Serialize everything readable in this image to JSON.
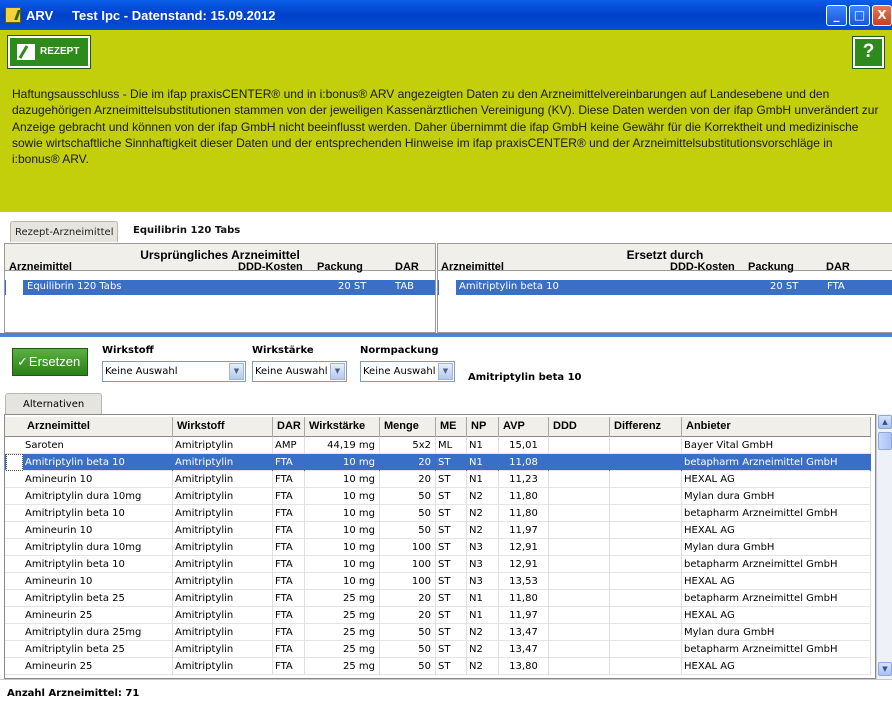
{
  "window": {
    "app": "ARV",
    "title": "Test Ipc - Datenstand: 15.09.2012",
    "controls": {
      "minimize": "_",
      "maximize": "□",
      "close": "X"
    }
  },
  "toolbar": {
    "rezept_label": "REZEPT",
    "help_label": "?"
  },
  "disclaimer": "Haftungsausschluss - Die im ifap praxisCENTER® und in i:bonus® ARV angezeigten Daten zu den Arzneimittelvereinbarungen auf Landesebene und den dazugehörigen Arzneimittelsubstitutionen stammen von der jeweiligen Kassenärztlichen Vereinigung (KV). Diese Daten werden von der ifap GmbH unverändert zur Anzeige gebracht und können von der ifap GmbH nicht beeinflusst werden. Daher übernimmt die ifap GmbH keine Gewähr für die Korrektheit und medizinische sowie wirtschaftliche Sinnhaftigkeit dieser Daten und der entsprechenden Hinweise im ifap praxisCENTER® und der Arzneimittelsubstitutionsvorschläge in i:bonus® ARV.",
  "tabs1": {
    "tab_label": "Rezept-Arzneimittel",
    "drug_title": "Equilibrin 120 Tabs"
  },
  "original": {
    "title": "Ursprüngliches Arzneimittel",
    "headers": {
      "arzneimittel": "Arzneimittel",
      "ddd": "DDD-Kosten",
      "packung": "Packung",
      "dar": "DAR"
    },
    "row": {
      "name": "Equilibrin 120 Tabs",
      "ddd": "",
      "packung": "20 ST",
      "dar": "TAB"
    }
  },
  "replacement": {
    "title": "Ersetzt durch",
    "headers": {
      "arzneimittel": "Arzneimittel",
      "ddd": "DDD-Kosten",
      "packung": "Packung",
      "dar": "DAR"
    },
    "row": {
      "name": "Amitriptylin beta 10",
      "ddd": "",
      "packung": "20 ST",
      "dar": "FTA"
    }
  },
  "filter": {
    "ersetzen_label": "Ersetzen",
    "wirkstoff_label": "Wirkstoff",
    "wirkstoff_value": "Keine Auswahl",
    "staerke_label": "Wirkstärke",
    "staerke_value": "Keine Auswahl",
    "norm_label": "Normpackung",
    "norm_value": "Keine Auswahl",
    "selected_name": "Amitriptylin beta 10"
  },
  "tabs2": {
    "tab_label": "Alternativen"
  },
  "grid": {
    "headers": [
      "Arzneimittel",
      "Wirkstoff",
      "DAR",
      "Wirkstärke",
      "Menge",
      "ME",
      "NP",
      "AVP",
      "DDD",
      "Differenz",
      "Anbieter"
    ],
    "rows": [
      [
        "Saroten",
        "Amitriptylin",
        "AMP",
        "44,19 mg",
        "5x2",
        "ML",
        "N1",
        "15,01",
        "",
        "",
        "Bayer Vital GmbH"
      ],
      [
        "Amitriptylin beta 10",
        "Amitriptylin",
        "FTA",
        "10 mg",
        "20",
        "ST",
        "N1",
        "11,08",
        "",
        "",
        "betapharm Arzneimittel GmbH"
      ],
      [
        "Amineurin 10",
        "Amitriptylin",
        "FTA",
        "10 mg",
        "20",
        "ST",
        "N1",
        "11,23",
        "",
        "",
        "HEXAL AG"
      ],
      [
        "Amitriptylin dura 10mg",
        "Amitriptylin",
        "FTA",
        "10 mg",
        "50",
        "ST",
        "N2",
        "11,80",
        "",
        "",
        "Mylan dura GmbH"
      ],
      [
        "Amitriptylin beta 10",
        "Amitriptylin",
        "FTA",
        "10 mg",
        "50",
        "ST",
        "N2",
        "11,80",
        "",
        "",
        "betapharm Arzneimittel GmbH"
      ],
      [
        "Amineurin 10",
        "Amitriptylin",
        "FTA",
        "10 mg",
        "50",
        "ST",
        "N2",
        "11,97",
        "",
        "",
        "HEXAL AG"
      ],
      [
        "Amitriptylin dura 10mg",
        "Amitriptylin",
        "FTA",
        "10 mg",
        "100",
        "ST",
        "N3",
        "12,91",
        "",
        "",
        "Mylan dura GmbH"
      ],
      [
        "Amitriptylin beta 10",
        "Amitriptylin",
        "FTA",
        "10 mg",
        "100",
        "ST",
        "N3",
        "12,91",
        "",
        "",
        "betapharm Arzneimittel GmbH"
      ],
      [
        "Amineurin 10",
        "Amitriptylin",
        "FTA",
        "10 mg",
        "100",
        "ST",
        "N3",
        "13,53",
        "",
        "",
        "HEXAL AG"
      ],
      [
        "Amitriptylin beta 25",
        "Amitriptylin",
        "FTA",
        "25 mg",
        "20",
        "ST",
        "N1",
        "11,80",
        "",
        "",
        "betapharm Arzneimittel GmbH"
      ],
      [
        "Amineurin 25",
        "Amitriptylin",
        "FTA",
        "25 mg",
        "20",
        "ST",
        "N1",
        "11,97",
        "",
        "",
        "HEXAL AG"
      ],
      [
        "Amitriptylin dura 25mg",
        "Amitriptylin",
        "FTA",
        "25 mg",
        "50",
        "ST",
        "N2",
        "13,47",
        "",
        "",
        "Mylan dura GmbH"
      ],
      [
        "Amitriptylin beta 25",
        "Amitriptylin",
        "FTA",
        "25 mg",
        "50",
        "ST",
        "N2",
        "13,47",
        "",
        "",
        "betapharm Arzneimittel GmbH"
      ],
      [
        "Amineurin 25",
        "Amitriptylin",
        "FTA",
        "25 mg",
        "50",
        "ST",
        "N2",
        "13,80",
        "",
        "",
        "HEXAL AG"
      ]
    ],
    "selected_index": 1
  },
  "status": "Anzahl Arzneimittel: 71"
}
